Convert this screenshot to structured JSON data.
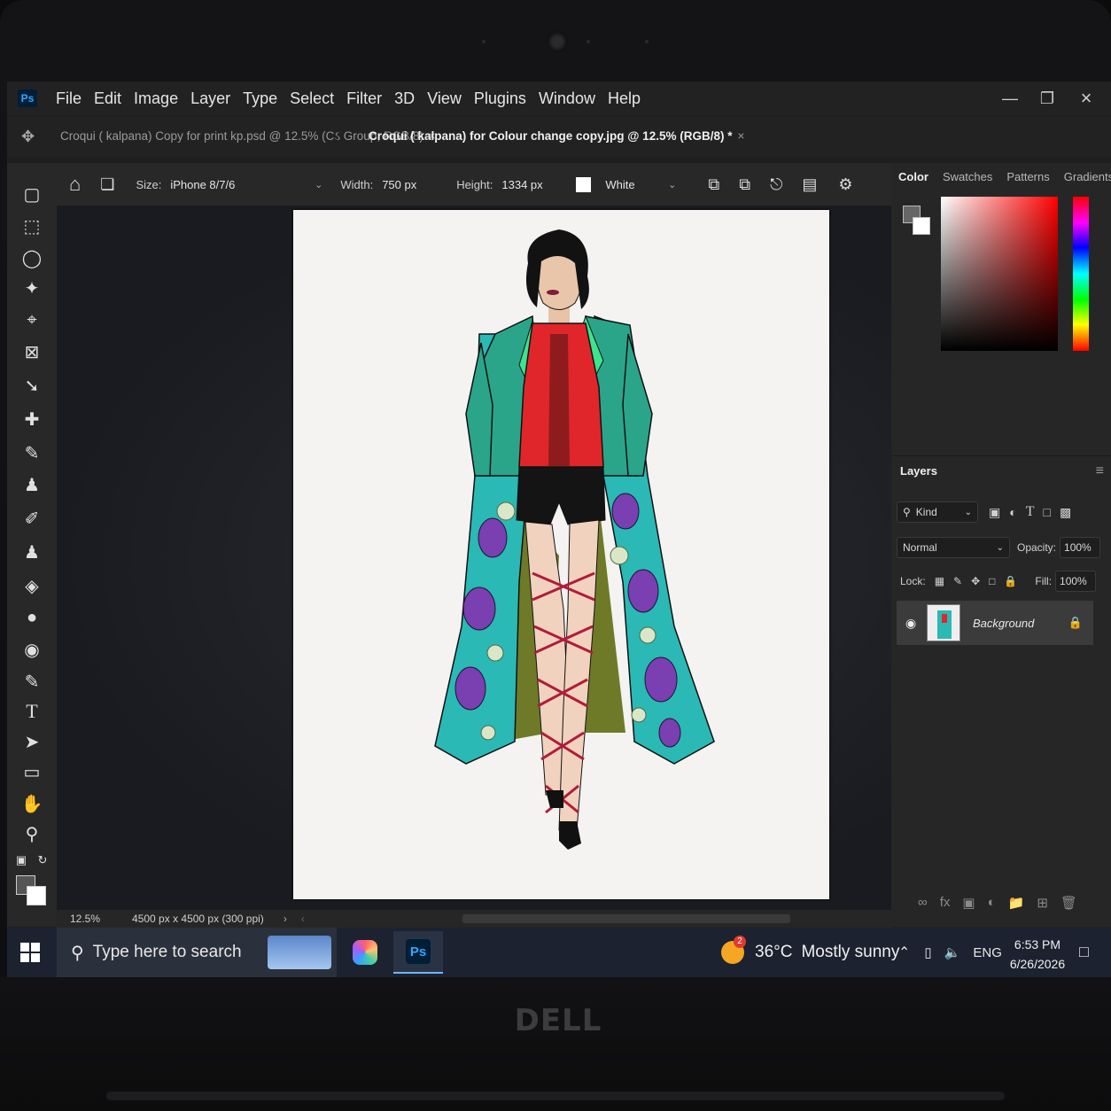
{
  "app": {
    "logo_text": "Ps",
    "menu": [
      "File",
      "Edit",
      "Image",
      "Layer",
      "Type",
      "Select",
      "Filter",
      "3D",
      "View",
      "Plugins",
      "Window",
      "Help"
    ]
  },
  "tabs": {
    "inactive_title": "Croqui ( kalpana) Copy for print kp.psd @ 12.5% (Cઽ Group, RGB/8)",
    "active_title": "Croqui ( kalpana) for Colour change copy.jpg @ 12.5% (RGB/8) *",
    "close": "×"
  },
  "options": {
    "size_label": "Size:",
    "size_value": "iPhone 8/7/6",
    "width_label": "Width:",
    "width_value": "750 px",
    "height_label": "Height:",
    "height_value": "1334 px",
    "fill_value": "White"
  },
  "status": {
    "zoom": "12.5%",
    "doc_size": "4500 px x 4500 px (300 ppi)"
  },
  "panels": {
    "color_tabs": [
      "Color",
      "Swatches",
      "Patterns",
      "Gradients"
    ],
    "layers_title": "Layers",
    "filter_kind": "Kind",
    "blend_mode": "Normal",
    "opacity_label": "Opacity:",
    "opacity_value": "100%",
    "lock_label": "Lock:",
    "fill_label": "Fill:",
    "fill_value": "100%",
    "layer_name": "Background"
  },
  "taskbar": {
    "search_placeholder": "Type here to search",
    "ps_label": "Ps",
    "weather_badge": "2",
    "temperature": "36°C",
    "weather": "Mostly sunny",
    "language": "ENG",
    "time": "6:53 PM",
    "date": "6/26/2026"
  },
  "brand": "DELL",
  "colors": {
    "ps_blue": "#31a8ff",
    "coat_green": "#2aa58a",
    "coat_print": "#2ab9b5",
    "top_red": "#e0262b",
    "peacock_purple": "#7a3fb0"
  }
}
